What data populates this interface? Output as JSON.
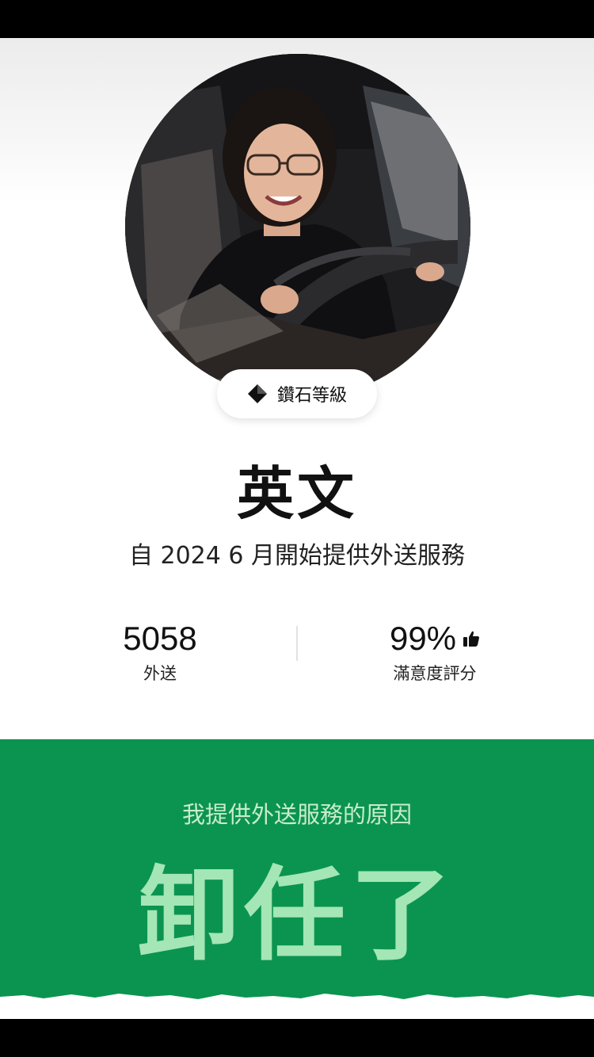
{
  "profile": {
    "tier": "鑽石等級",
    "tier_icon": "diamond-icon",
    "name": "英文",
    "since": "自 2024 6 月開始提供外送服務"
  },
  "stats": {
    "deliveries_value": "5058",
    "deliveries_label": "外送",
    "rating_value": "99%",
    "rating_label": "滿意度評分",
    "rating_icon": "thumbs-up-icon"
  },
  "reason": {
    "heading": "我提供外送服務的原因",
    "text": "卸任了"
  },
  "colors": {
    "green_panel": "#0b9450",
    "reason_text": "#a4e6b5",
    "heading_text": "#c9eccc"
  }
}
